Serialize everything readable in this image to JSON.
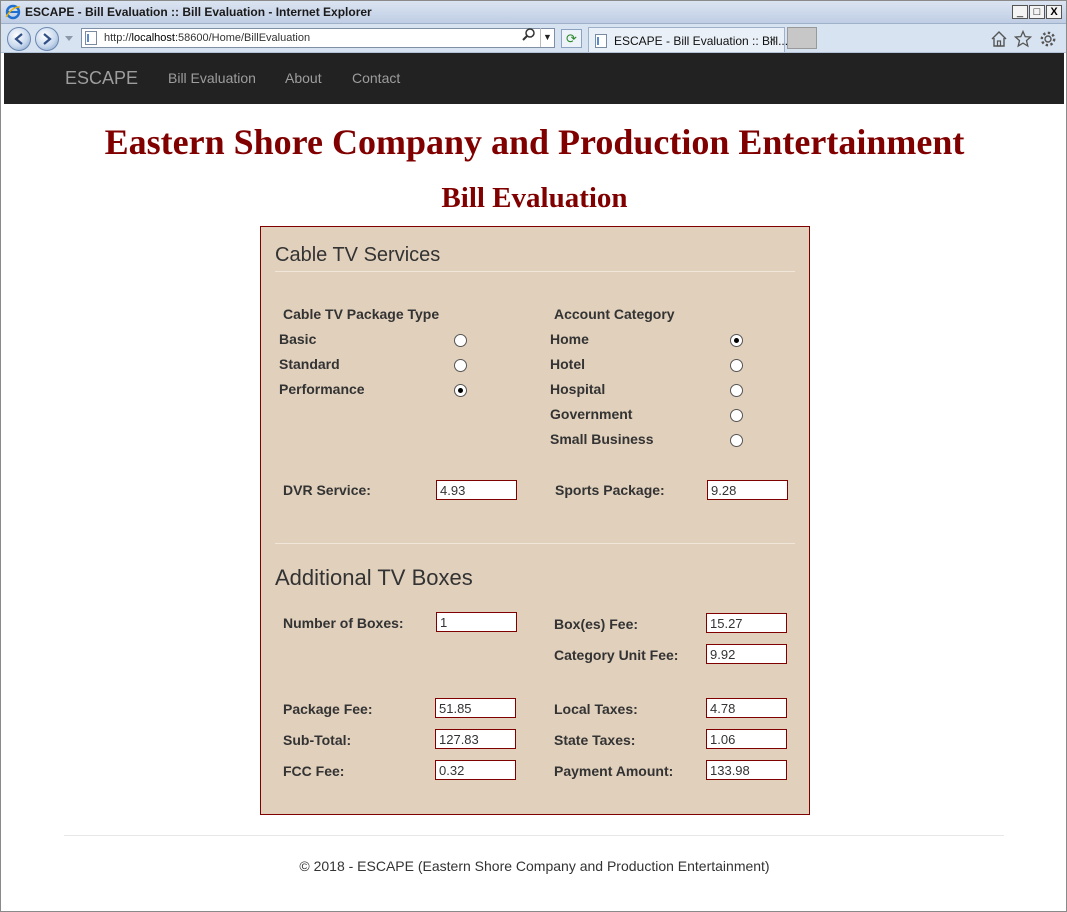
{
  "window": {
    "title": "ESCAPE - Bill Evaluation :: Bill Evaluation - Internet Explorer",
    "minimize": "_",
    "maximize": "□",
    "close": "X"
  },
  "browser": {
    "url_prefix": "http://",
    "url_host": "localhost",
    "url_rest": ":58600/Home/BillEvaluation",
    "tab_label": "ESCAPE - Bill Evaluation :: Bill...",
    "tab_close": "×"
  },
  "navbar": {
    "brand": "ESCAPE",
    "links": [
      "Bill Evaluation",
      "About",
      "Contact"
    ]
  },
  "page": {
    "company": "Eastern Shore Company and Production Entertainment",
    "subtitle": "Bill Evaluation"
  },
  "cable": {
    "section_title": "Cable TV Services",
    "package_heading": "Cable TV Package Type",
    "packages": [
      {
        "label": "Basic",
        "selected": false
      },
      {
        "label": "Standard",
        "selected": false
      },
      {
        "label": "Performance",
        "selected": true
      }
    ],
    "category_heading": "Account Category",
    "categories": [
      {
        "label": "Home",
        "selected": true
      },
      {
        "label": "Hotel",
        "selected": false
      },
      {
        "label": "Hospital",
        "selected": false
      },
      {
        "label": "Government",
        "selected": false
      },
      {
        "label": "Small Business",
        "selected": false
      }
    ],
    "dvr_label": "DVR Service:",
    "dvr_value": "4.93",
    "sports_label": "Sports Package:",
    "sports_value": "9.28"
  },
  "boxes": {
    "section_title": "Additional TV Boxes",
    "num_label": "Number of Boxes:",
    "num_value": "1",
    "boxfee_label": "Box(es) Fee:",
    "boxfee_value": "15.27",
    "catfee_label": "Category Unit Fee:",
    "catfee_value": "9.92",
    "pkgfee_label": "Package Fee:",
    "pkgfee_value": "51.85",
    "localtax_label": "Local Taxes:",
    "localtax_value": "4.78",
    "subtotal_label": "Sub-Total:",
    "subtotal_value": "127.83",
    "statetax_label": "State Taxes:",
    "statetax_value": "1.06",
    "fcc_label": "FCC Fee:",
    "fcc_value": "0.32",
    "payment_label": "Payment Amount:",
    "payment_value": "133.98"
  },
  "footer": {
    "text": "© 2018 - ESCAPE (Eastern Shore Company and Production Entertainment)"
  }
}
